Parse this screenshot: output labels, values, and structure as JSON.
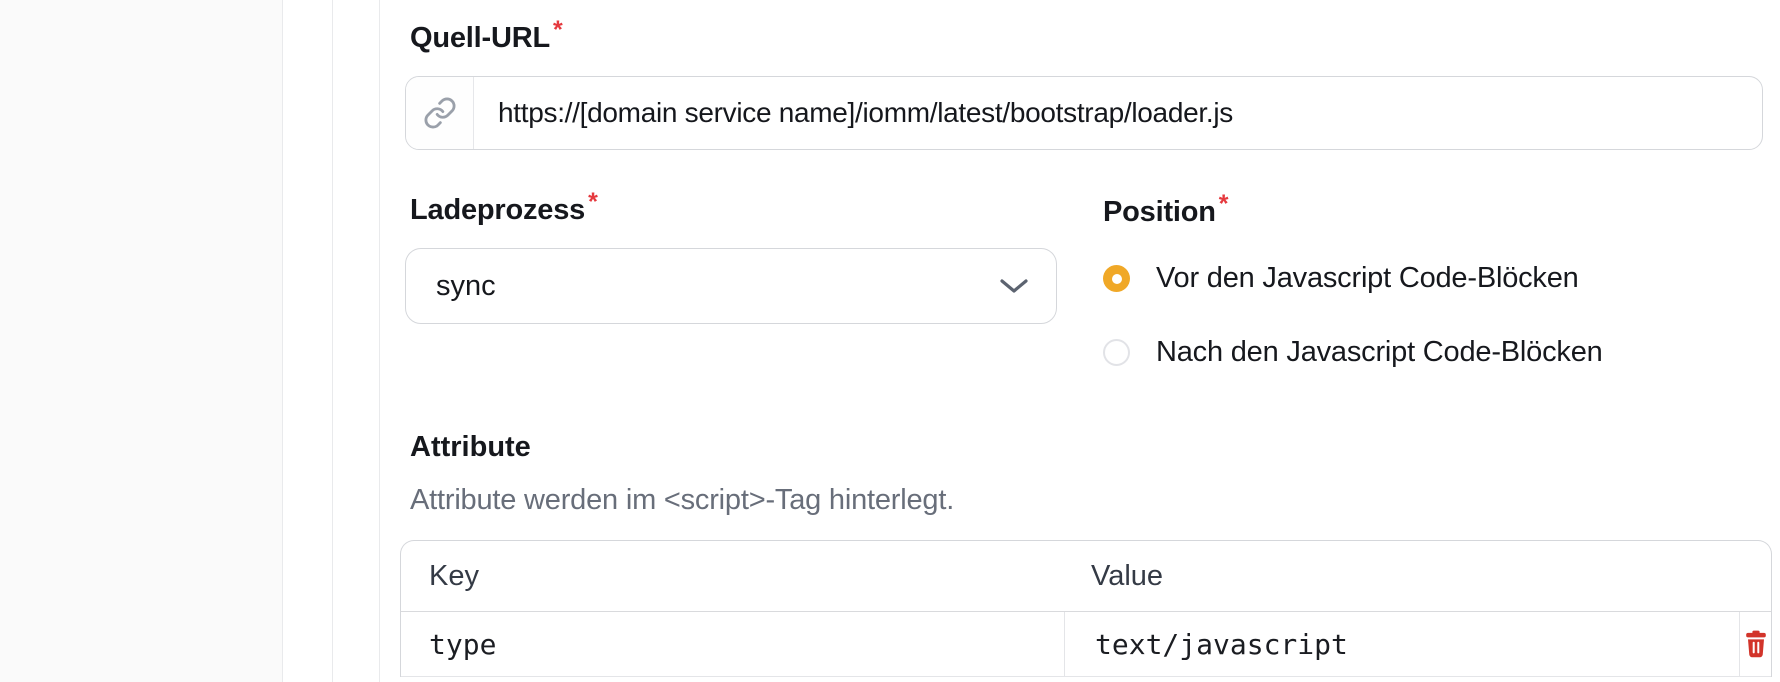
{
  "colors": {
    "required_marker": "#e5393e",
    "radio_selected": "#f0a827",
    "delete_icon": "#d2342a",
    "sidebar_background": "#fafafa",
    "input_border": "#d5d7db"
  },
  "form": {
    "required_marker": "*",
    "source_url": {
      "label": "Quell-URL",
      "required": true,
      "icon": "link-icon",
      "value": "https://[domain service name]/iomm/latest/bootstrap/loader.js"
    },
    "load_process": {
      "label": "Ladeprozess",
      "required": true,
      "selected_option": "sync",
      "icon": "chevron-down-icon"
    },
    "position": {
      "label": "Position",
      "required": true,
      "options": [
        {
          "label": "Vor den Javascript Code-Blöcken",
          "selected": true
        },
        {
          "label": "Nach den Javascript Code-Blöcken",
          "selected": false
        }
      ]
    },
    "attributes": {
      "heading": "Attribute",
      "description": "Attribute werden im <script>-Tag hinterlegt.",
      "table": {
        "columns": [
          "Key",
          "Value"
        ],
        "rows": [
          {
            "key": "type",
            "value": "text/javascript",
            "action_icon": "trash-icon"
          }
        ]
      }
    }
  }
}
